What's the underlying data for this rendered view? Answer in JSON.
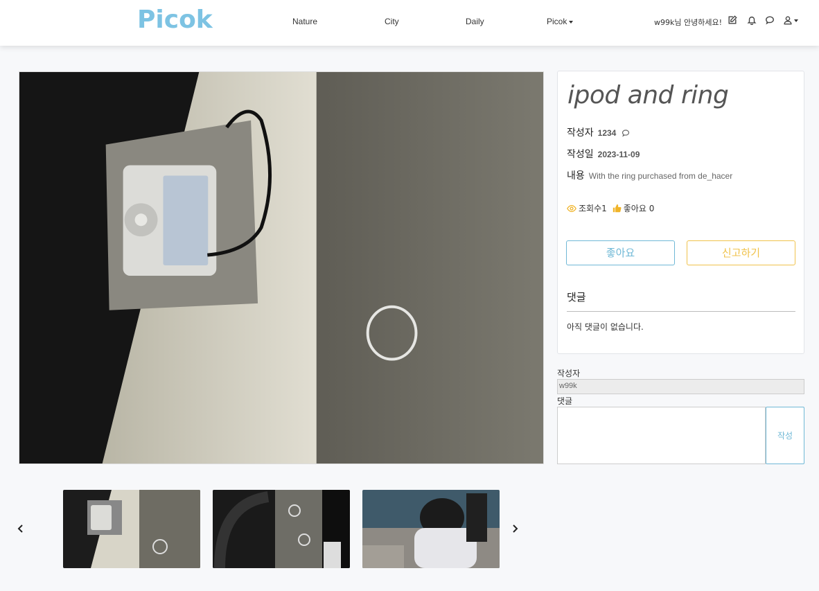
{
  "header": {
    "logo": "Picok",
    "brand_color": "#7dc3e3",
    "nav": [
      {
        "label": "Nature"
      },
      {
        "label": "City"
      },
      {
        "label": "Daily"
      },
      {
        "label": "Picok"
      }
    ],
    "greeting": "w99k님 안녕하세요!",
    "icons": [
      "edit-icon",
      "bell-icon",
      "chat-icon",
      "user-icon"
    ]
  },
  "post": {
    "title": "ipod and ring",
    "author_label": "작성자",
    "author": "1234",
    "date_label": "작성일",
    "date": "2023-11-09",
    "content_label": "내용",
    "content": "With the ring purchased from de_hacer",
    "views_label": "조회수1",
    "likes_label": "좋아요 0",
    "like_button": "좋아요",
    "report_button": "신고하기",
    "comments_title": "댓글",
    "no_comments": "아직 댓글이 없습니다."
  },
  "comment_form": {
    "author_label": "작성자",
    "author_value": "w99k",
    "comment_label": "댓글",
    "submit": "작성"
  },
  "colors": {
    "accent": "#6fb8d6",
    "warning": "#f0c24b"
  }
}
